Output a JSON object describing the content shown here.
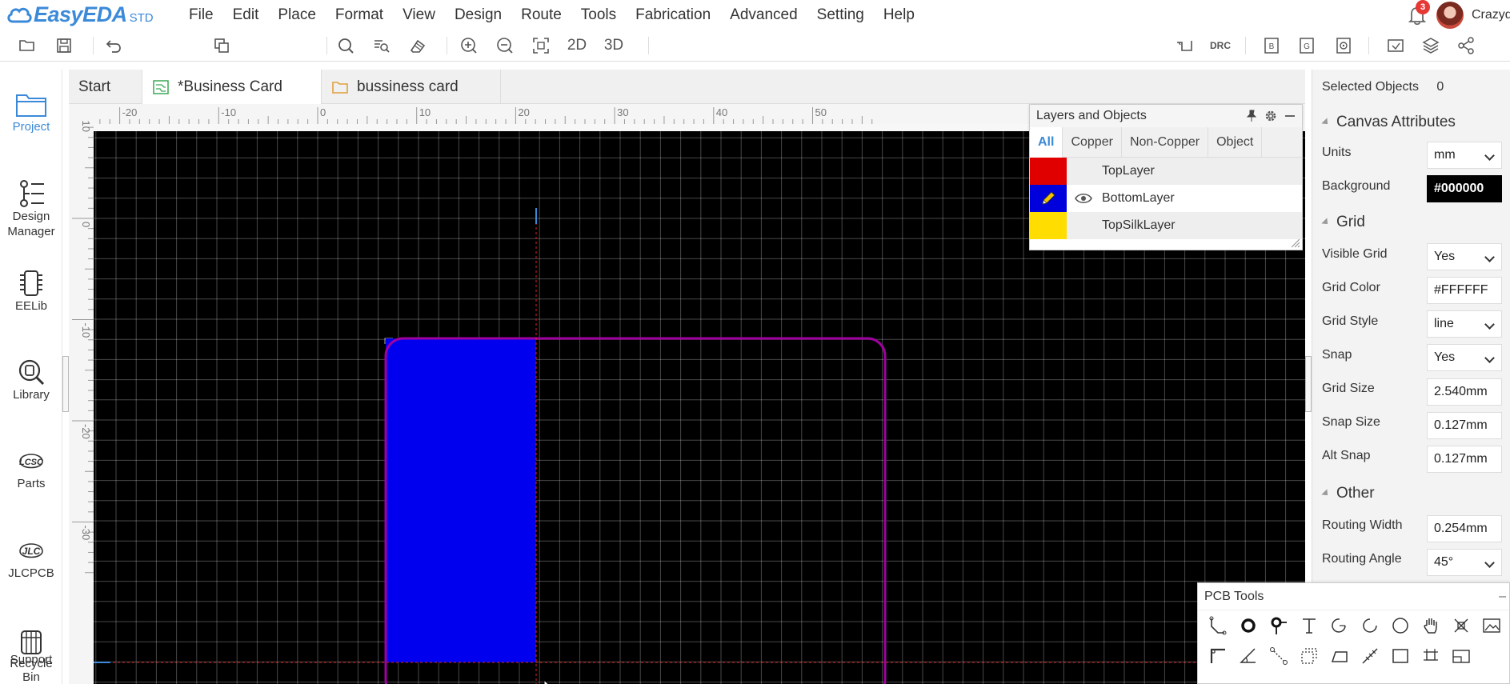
{
  "app": {
    "brand": "EasyEDA",
    "edition": "STD",
    "menu": [
      "File",
      "Edit",
      "Place",
      "Format",
      "View",
      "Design",
      "Route",
      "Tools",
      "Fabrication",
      "Advanced",
      "Setting",
      "Help"
    ],
    "notification_count": "3",
    "username": "Crazydna"
  },
  "toolbar": {
    "view_2d": "2D",
    "view_3d": "3D",
    "drc": "DRC",
    "bom": "B",
    "gerber": "G"
  },
  "sidebar": {
    "items": [
      {
        "label": "Project",
        "icon": "project-folder-icon"
      },
      {
        "label": "Design Manager",
        "icon": "design-manager-icon"
      },
      {
        "label": "EELib",
        "icon": "eelib-chip-icon"
      },
      {
        "label": "Library",
        "icon": "library-search-icon"
      },
      {
        "label": "Parts",
        "icon": "lcsc-parts-icon"
      },
      {
        "label": "JLCPCB",
        "icon": "jlcpcb-icon"
      },
      {
        "label": "Support",
        "icon": "support-icon"
      },
      {
        "label": "Recycle Bin",
        "icon": "recycle-bin-icon"
      }
    ]
  },
  "tabs": [
    {
      "label": "Start"
    },
    {
      "label": "*Business Card"
    },
    {
      "label": "bussiness card"
    }
  ],
  "canvas": {
    "background": "#000000",
    "grid_color": "#FFFFFF",
    "board_outline_color": "#a100a1",
    "bottom_layer_color": "#0000ee",
    "ruler_top_labels": [
      "-20",
      "-10",
      "0",
      "10",
      "20",
      "30",
      "40",
      "50"
    ],
    "ruler_left_labels": [
      "10",
      "0",
      "-10",
      "-20",
      "-30"
    ]
  },
  "layers_panel": {
    "title": "Layers and Objects",
    "tabs": [
      "All",
      "Copper",
      "Non-Copper",
      "Object"
    ],
    "layers": [
      {
        "name": "TopLayer",
        "color": "#e00000"
      },
      {
        "name": "BottomLayer",
        "color": "#0000dd"
      },
      {
        "name": "TopSilkLayer",
        "color": "#ffdd00"
      }
    ]
  },
  "right_panel": {
    "selected_label": "Selected Objects",
    "selected_count": "0",
    "canvas_section": "Canvas Attributes",
    "units_label": "Units",
    "units_value": "mm",
    "background_label": "Background",
    "background_value": "#000000",
    "grid_section": "Grid",
    "visible_grid_label": "Visible Grid",
    "visible_grid_value": "Yes",
    "grid_color_label": "Grid Color",
    "grid_color_value": "#FFFFFF",
    "grid_style_label": "Grid Style",
    "grid_style_value": "line",
    "snap_label": "Snap",
    "snap_value": "Yes",
    "grid_size_label": "Grid Size",
    "grid_size_value": "2.540mm",
    "snap_size_label": "Snap Size",
    "snap_size_value": "0.127mm",
    "alt_snap_label": "Alt Snap",
    "alt_snap_value": "0.127mm",
    "other_section": "Other",
    "routing_width_label": "Routing Width",
    "routing_width_value": "0.254mm",
    "routing_angle_label": "Routing Angle",
    "routing_angle_value": "45°"
  },
  "pcb_tools": {
    "title": "PCB Tools"
  }
}
